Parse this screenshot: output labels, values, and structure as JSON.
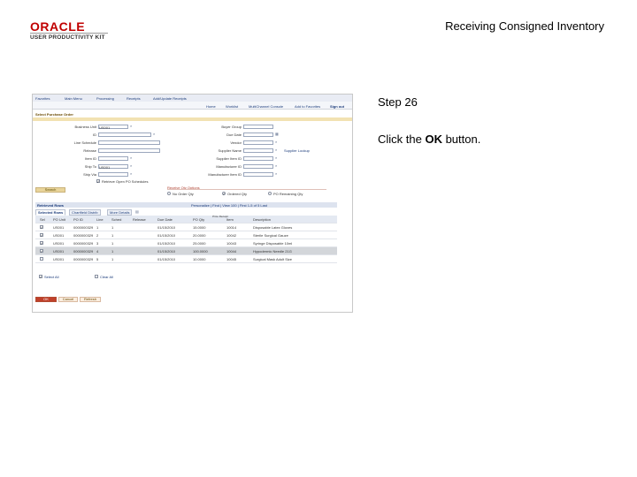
{
  "header": {
    "logo_word": "ORACLE",
    "logo_subtitle": "USER PRODUCTIVITY KIT",
    "doc_title": "Receiving Consigned Inventory"
  },
  "step": {
    "label": "Step 26"
  },
  "instruction": {
    "before": "Click the ",
    "bold": "OK",
    "after": " button."
  },
  "screenshot": {
    "breadcrumbs": [
      "Favorites",
      "Main Menu",
      "Processing",
      "Receipts",
      "Add/Update Receipts"
    ],
    "nav_links": [
      "Home",
      "Worklist",
      "MultiChannel Console",
      "Add to Favorites",
      "Sign out"
    ],
    "page_title": "Select Purchase Order",
    "fields_left": [
      {
        "label": "Business Unit",
        "value": "US001"
      },
      {
        "label": "ID",
        "value": ""
      },
      {
        "label": "Line Schedule",
        "value": ""
      },
      {
        "label": "Release",
        "value": ""
      },
      {
        "label": "Item ID",
        "value": ""
      },
      {
        "label": "Ship To",
        "value": "US001"
      },
      {
        "label": "Ship Via",
        "value": ""
      }
    ],
    "fields_right": [
      {
        "label": "Buyer Group",
        "value": ""
      },
      {
        "label": "Due Date",
        "value": ""
      },
      {
        "label": "Vendor",
        "value": ""
      },
      {
        "label": "Supplier Name",
        "value": ""
      },
      {
        "label": "Supplier Item ID",
        "value": ""
      },
      {
        "label": "Manufacturer ID",
        "value": ""
      },
      {
        "label": "Manufacturer Item ID",
        "value": ""
      }
    ],
    "include_closed": "Retrieve Open PO Schedules",
    "supplier_lookup": "Supplier Lookup",
    "search_button": "Search",
    "receive_qty_title": "Receive Qty Options",
    "receive_options": [
      "No Order Qty",
      "Ordered Qty",
      "PO Remaining Qty"
    ],
    "grid_title": "Retrieved Rows",
    "grid_nav": "Personalize | Find | View 100 | First  1-5 of 5  Last",
    "tabs": [
      "Selected Rows",
      "Chartfield Distrib",
      "More Details"
    ],
    "columns": [
      "Sel",
      "PO Unit",
      "PO ID",
      "Line",
      "Sched",
      "Release",
      "Due Date",
      "PO Qty",
      "Price Receipt",
      "Item",
      "Description"
    ],
    "rows": [
      {
        "checked": true,
        "unit": "US001",
        "po": "0000000329",
        "line": "1",
        "sched": "1",
        "release": "",
        "due": "01/15/2010",
        "qty": "15.0000",
        "item": "10014",
        "desc": "Disposable Latex Gloves"
      },
      {
        "checked": true,
        "unit": "US001",
        "po": "0000000329",
        "line": "2",
        "sched": "1",
        "release": "",
        "due": "01/15/2010",
        "qty": "20.0000",
        "item": "10042",
        "desc": "Sterile Surgical Gauze"
      },
      {
        "checked": true,
        "unit": "US001",
        "po": "0000000329",
        "line": "3",
        "sched": "1",
        "release": "",
        "due": "01/15/2010",
        "qty": "25.0000",
        "item": "10043",
        "desc": "Syringe Disposable 10ml"
      },
      {
        "checked": true,
        "unit": "US001",
        "po": "0000000329",
        "line": "4",
        "sched": "1",
        "release": "",
        "due": "01/15/2010",
        "qty": "100.0000",
        "item": "10044",
        "desc": "Hypodermic Needle 21G"
      },
      {
        "checked": false,
        "unit": "US001",
        "po": "0000000329",
        "line": "5",
        "sched": "1",
        "release": "",
        "due": "01/15/2010",
        "qty": "10.0000",
        "item": "10045",
        "desc": "Surgical Mask Adult Size"
      }
    ],
    "select_all": "Select All",
    "clear_all": "Clear All",
    "bottom_buttons": [
      "OK",
      "Cancel",
      "Refresh"
    ],
    "colors": {
      "accent_red": "#c0402a",
      "header_blue": "#1b3b7a",
      "band_gold": "#f2e2b2"
    }
  }
}
